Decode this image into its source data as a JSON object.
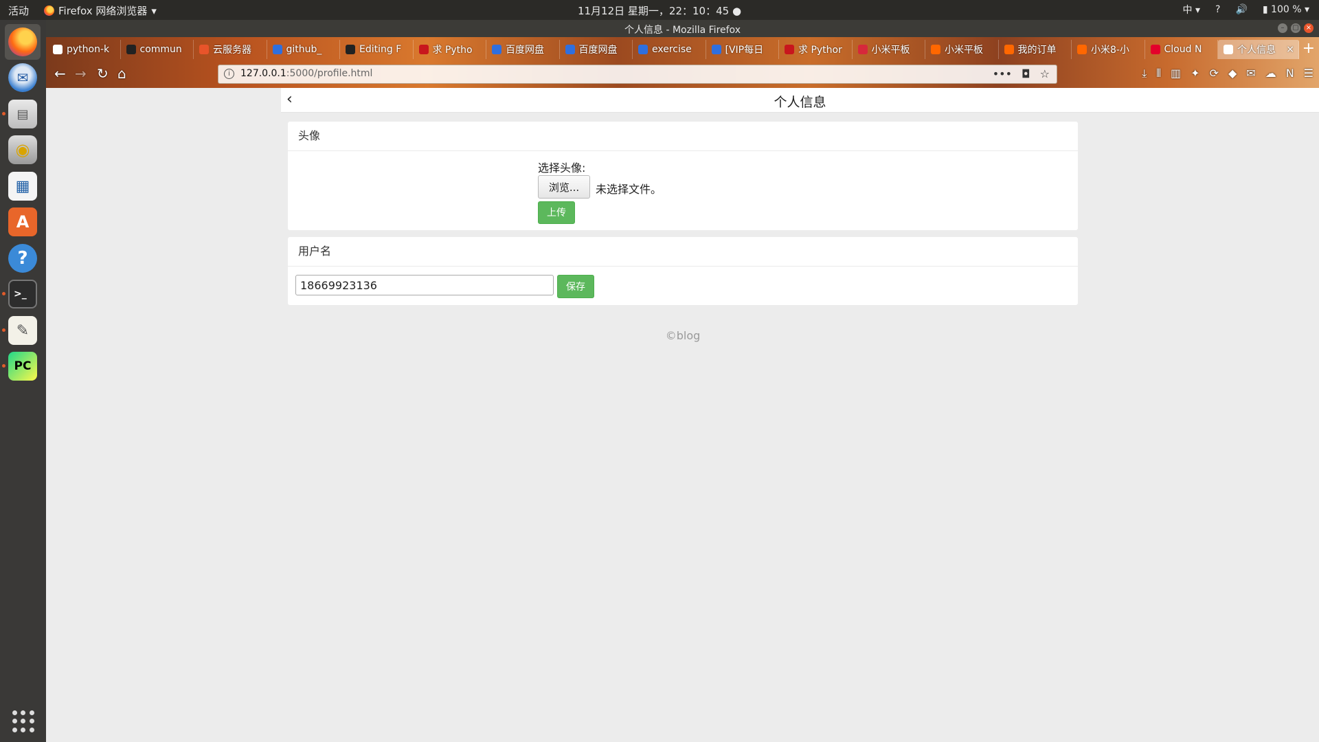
{
  "system_bar": {
    "activities": "活动",
    "app_menu": "Firefox 网络浏览器",
    "clock": "11月12日 星期一，22：10：45",
    "input_method": "中",
    "help": "?",
    "battery": "100 %"
  },
  "window": {
    "title": "个人信息 - Mozilla Firefox"
  },
  "tabs": [
    {
      "label": "python-k",
      "color": "#ffffff"
    },
    {
      "label": "commun",
      "color": "#222222"
    },
    {
      "label": "云服务器",
      "color": "#e8542a"
    },
    {
      "label": "github_",
      "color": "#2f6fde"
    },
    {
      "label": "Editing F",
      "color": "#222222"
    },
    {
      "label": "求 Pytho",
      "color": "#c8161d"
    },
    {
      "label": "百度网盘",
      "color": "#2f6fde"
    },
    {
      "label": "百度网盘",
      "color": "#2f6fde"
    },
    {
      "label": "exercise",
      "color": "#2f6fde"
    },
    {
      "label": "[VIP每日",
      "color": "#2f6fde"
    },
    {
      "label": "求 Pythor",
      "color": "#c8161d"
    },
    {
      "label": "小米平板",
      "color": "#d6283b"
    },
    {
      "label": "小米平板",
      "color": "#ff6700"
    },
    {
      "label": "我的订单",
      "color": "#ff6700"
    },
    {
      "label": "小米8-小",
      "color": "#ff6700"
    },
    {
      "label": "Cloud N",
      "color": "#e4002b"
    },
    {
      "label": "个人信息",
      "color": "#ffffff",
      "active": true
    }
  ],
  "url": {
    "host": "127.0.0.1",
    "path": ":5000/profile.html"
  },
  "page": {
    "title": "个人信息",
    "avatar_section": {
      "heading": "头像",
      "choose_label": "选择头像:",
      "browse_button": "浏览...",
      "no_file": "未选择文件。",
      "upload_button": "上传"
    },
    "username_section": {
      "heading": "用户名",
      "value": "18669923136",
      "save_button": "保存"
    },
    "footer": "©blog"
  },
  "colors": {
    "success": "#5cb85c",
    "page_bg": "#ececec"
  }
}
